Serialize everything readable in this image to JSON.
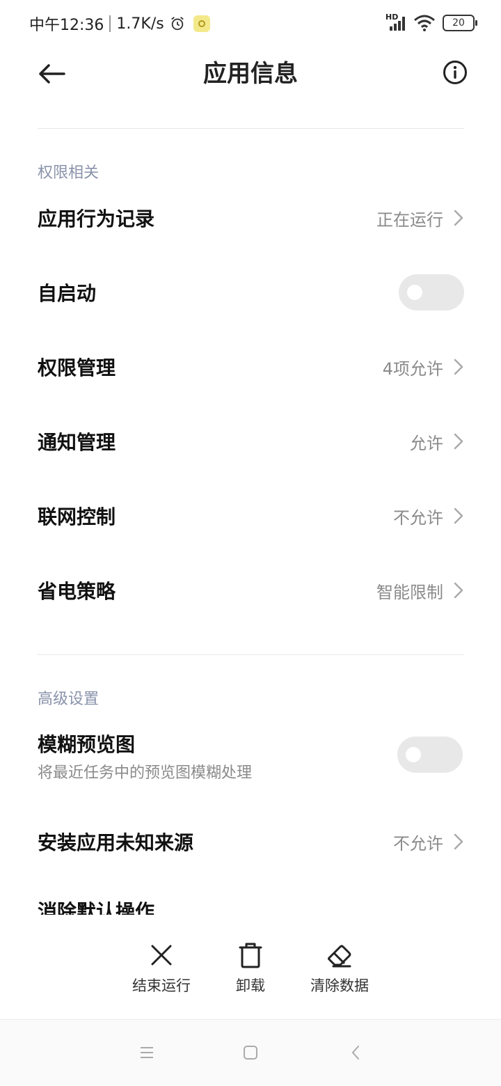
{
  "status_bar": {
    "time": "中午12:36",
    "speed": "1.7K/s",
    "network": "HD",
    "battery": "20"
  },
  "header": {
    "title": "应用信息"
  },
  "sections": {
    "permissions_title": "权限相关",
    "advanced_title": "高级设置"
  },
  "rows": [
    {
      "label": "应用行为记录",
      "value": "正在运行"
    },
    {
      "label": "自启动"
    },
    {
      "label": "权限管理",
      "value": "4项允许"
    },
    {
      "label": "通知管理",
      "value": "允许"
    },
    {
      "label": "联网控制",
      "value": "不允许"
    },
    {
      "label": "省电策略",
      "value": "智能限制"
    }
  ],
  "advanced": {
    "blur_label": "模糊预览图",
    "blur_sub": "将最近任务中的预览图模糊处理",
    "unknown_source_label": "安装应用未知来源",
    "unknown_source_value": "不允许",
    "clear_defaults_label": "消除默认操作"
  },
  "toggles": {
    "autostart": false,
    "blur_preview": false
  },
  "actions": {
    "stop": "结束运行",
    "uninstall": "卸载",
    "clear_data": "清除数据"
  }
}
